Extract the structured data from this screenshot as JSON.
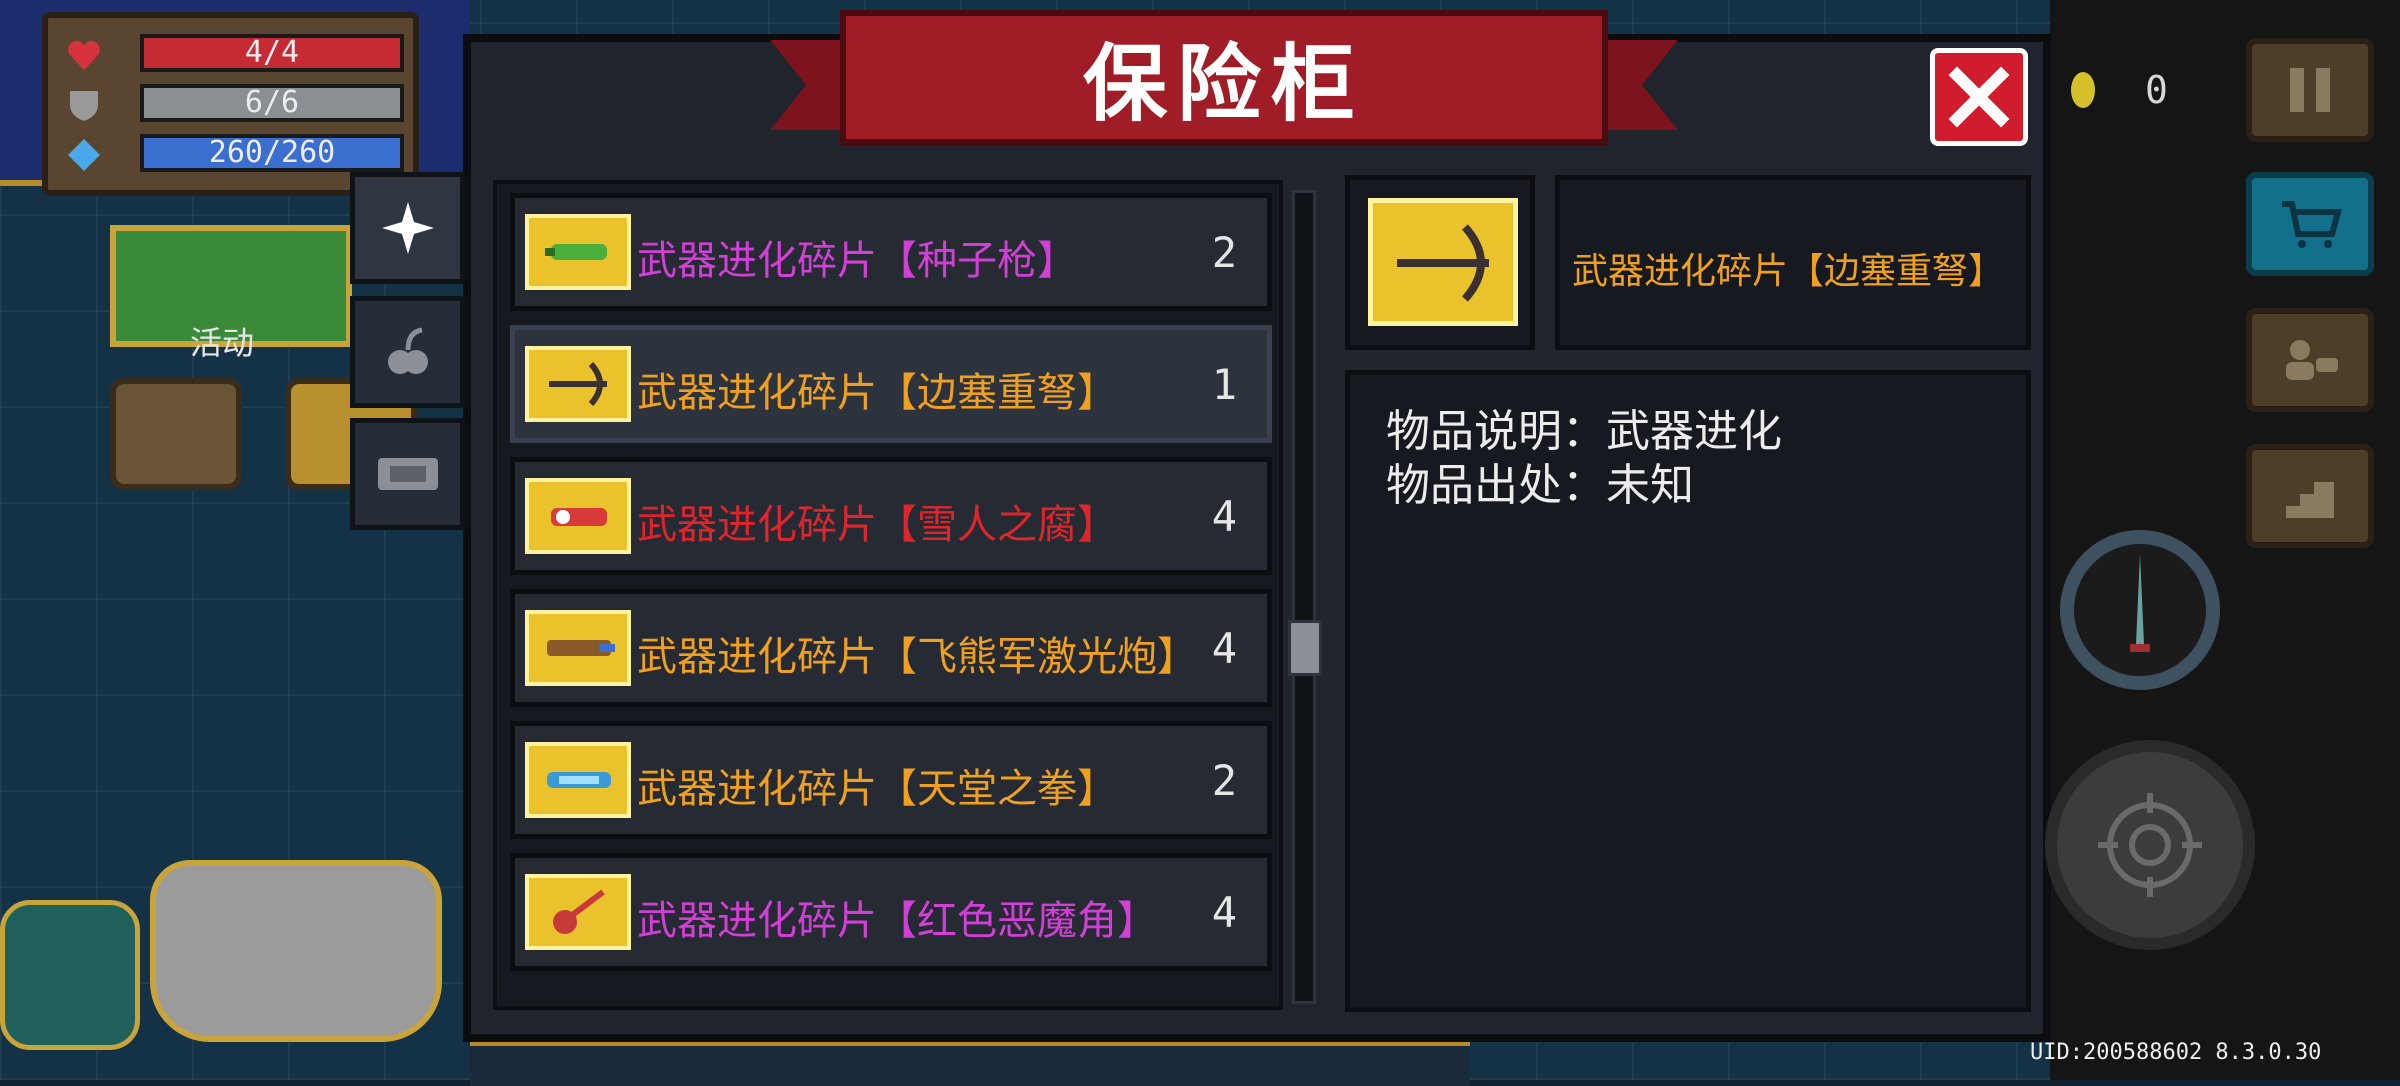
{
  "stats": {
    "hp": "4/4",
    "armor": "6/6",
    "energy": "260/260"
  },
  "hud": {
    "activity_label": "活动",
    "coins": "0",
    "uid": "UID:200588602 8.3.0.30"
  },
  "vault": {
    "title": "保险柜",
    "side_tabs": [
      {
        "name": "weapon-tab",
        "icon": "sparkle-icon"
      },
      {
        "name": "plant-tab",
        "icon": "plant-icon"
      },
      {
        "name": "ticket-tab",
        "icon": "ticket-icon"
      }
    ],
    "items": [
      {
        "name": "武器进化碎片【种子枪】",
        "qty": "2",
        "color": "#d13fd6",
        "icon": "seed-gun-icon"
      },
      {
        "name": "武器进化碎片【边塞重弩】",
        "qty": "1",
        "color": "#f0a020",
        "icon": "crossbow-icon"
      },
      {
        "name": "武器进化碎片【雪人之腐】",
        "qty": "4",
        "color": "#e0242c",
        "icon": "snowman-gun-icon"
      },
      {
        "name": "武器进化碎片【飞熊军激光炮】",
        "qty": "4",
        "color": "#f0a020",
        "icon": "laser-cannon-icon"
      },
      {
        "name": "武器进化碎片【天堂之拳】",
        "qty": "2",
        "color": "#f0a020",
        "icon": "heaven-fist-icon"
      },
      {
        "name": "武器进化碎片【红色恶魔角】",
        "qty": "4",
        "color": "#d13fd6",
        "icon": "red-demon-horn-icon"
      }
    ],
    "selected_index": 1,
    "detail": {
      "name": "武器进化碎片【边塞重弩】",
      "name_color": "#f0a020",
      "description": "物品说明：武器进化",
      "source": "物品出处：未知"
    }
  }
}
